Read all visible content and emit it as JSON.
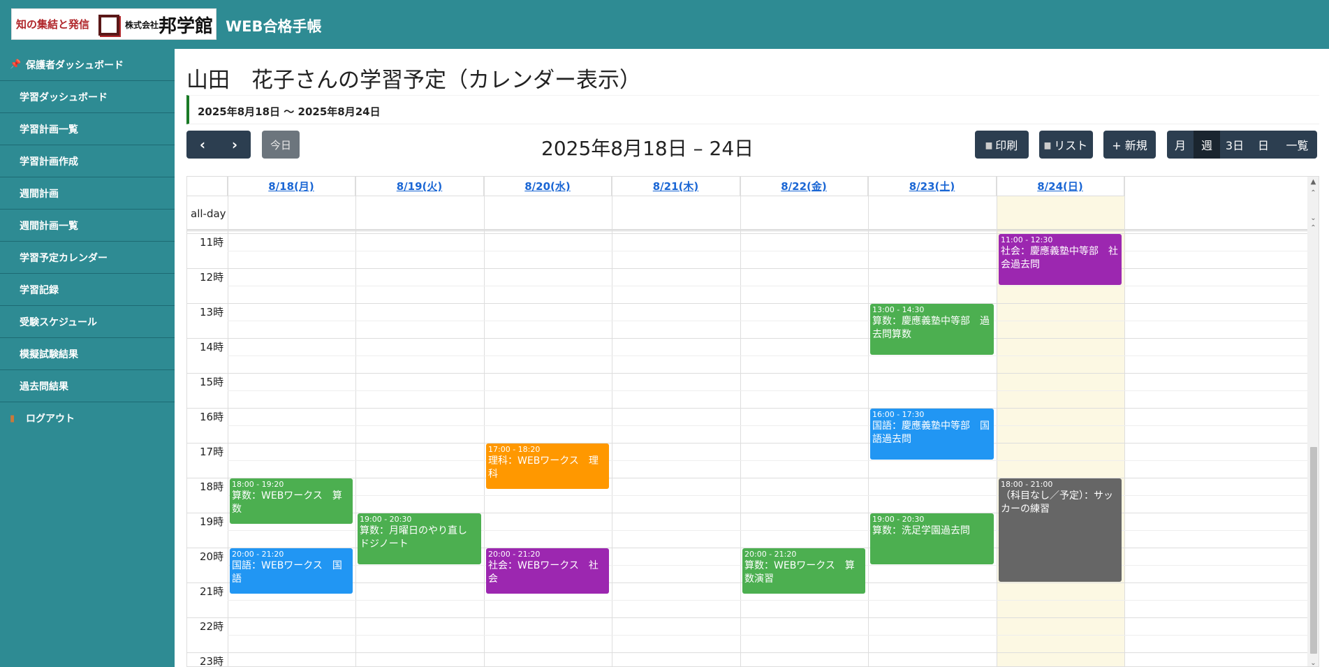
{
  "header": {
    "logo": {
      "tagline": "知の集結と発信",
      "company": "株式会社",
      "name": "邦学館"
    },
    "app_title": "WEB合格手帳"
  },
  "sidebar": {
    "items": [
      {
        "label": "保護者ダッシュボード",
        "icon": "pin-icon"
      },
      {
        "label": "学習ダッシュボード"
      },
      {
        "label": "学習計画一覧"
      },
      {
        "label": "学習計画作成"
      },
      {
        "label": "週間計画"
      },
      {
        "label": "週間計画一覧"
      },
      {
        "label": "学習予定カレンダー"
      },
      {
        "label": "学習記録"
      },
      {
        "label": "受験スケジュール"
      },
      {
        "label": "模擬試験結果"
      },
      {
        "label": "過去問結果"
      },
      {
        "label": "ログアウト",
        "icon": "door-icon"
      }
    ]
  },
  "main": {
    "page_title": "山田　花子さんの学習予定（カレンダー表示）",
    "range_text": "2025年8月18日 〜 2025年8月24日"
  },
  "toolbar": {
    "prev": "‹",
    "next": "›",
    "today": "今日",
    "title": "2025年8月18日 – 24日",
    "print": "印刷",
    "list": "リスト",
    "new": "+ 新規",
    "views": [
      "月",
      "週",
      "3日",
      "日",
      "一覧"
    ],
    "active_view": "週"
  },
  "calendar": {
    "days": [
      "8/18(月)",
      "8/19(火)",
      "8/20(水)",
      "8/21(木)",
      "8/22(金)",
      "8/23(土)",
      "8/24(日)"
    ],
    "allday_label": "all-day",
    "hours": [
      "11時",
      "12時",
      "13時",
      "14時",
      "15時",
      "16時",
      "17時",
      "18時",
      "19時",
      "20時",
      "21時",
      "22時",
      "23時"
    ],
    "highlight_day": "8/23(土)",
    "events": [
      {
        "day": 0,
        "start": 18.0,
        "end": 19.333,
        "time": "18:00 - 19:20",
        "title": "算数：WEBワークス　算数",
        "color": "#4caf50"
      },
      {
        "day": 0,
        "start": 20.0,
        "end": 21.333,
        "time": "20:00 - 21:20",
        "title": "国語：WEBワークス　国語",
        "color": "#2196f3"
      },
      {
        "day": 1,
        "start": 19.0,
        "end": 20.5,
        "time": "19:00 - 20:30",
        "title": "算数：月曜日のやり直し　ドジノート",
        "color": "#4caf50"
      },
      {
        "day": 2,
        "start": 17.0,
        "end": 18.333,
        "time": "17:00 - 18:20",
        "title": "理科：WEBワークス　理科",
        "color": "#ff9800"
      },
      {
        "day": 2,
        "start": 20.0,
        "end": 21.333,
        "time": "20:00 - 21:20",
        "title": "社会：WEBワークス　社会",
        "color": "#9c27b0"
      },
      {
        "day": 4,
        "start": 20.0,
        "end": 21.333,
        "time": "20:00 - 21:20",
        "title": "算数：WEBワークス　算数演習",
        "color": "#4caf50"
      },
      {
        "day": 5,
        "start": 13.0,
        "end": 14.5,
        "time": "13:00 - 14:30",
        "title": "算数：慶應義塾中等部　過去問算数",
        "color": "#4caf50"
      },
      {
        "day": 5,
        "start": 16.0,
        "end": 17.5,
        "time": "16:00 - 17:30",
        "title": "国語：慶應義塾中等部　国語過去問",
        "color": "#2196f3"
      },
      {
        "day": 5,
        "start": 19.0,
        "end": 20.5,
        "time": "19:00 - 20:30",
        "title": "算数：洗足学園過去問",
        "color": "#4caf50"
      },
      {
        "day": 6,
        "start": 11.0,
        "end": 12.5,
        "time": "11:00 - 12:30",
        "title": "社会：慶應義塾中等部　社会過去問",
        "color": "#9c27b0"
      },
      {
        "day": 6,
        "start": 18.0,
        "end": 21.0,
        "time": "18:00 - 21:00",
        "title": "（科目なし／予定）：サッカーの練習",
        "color": "#666666"
      }
    ]
  }
}
